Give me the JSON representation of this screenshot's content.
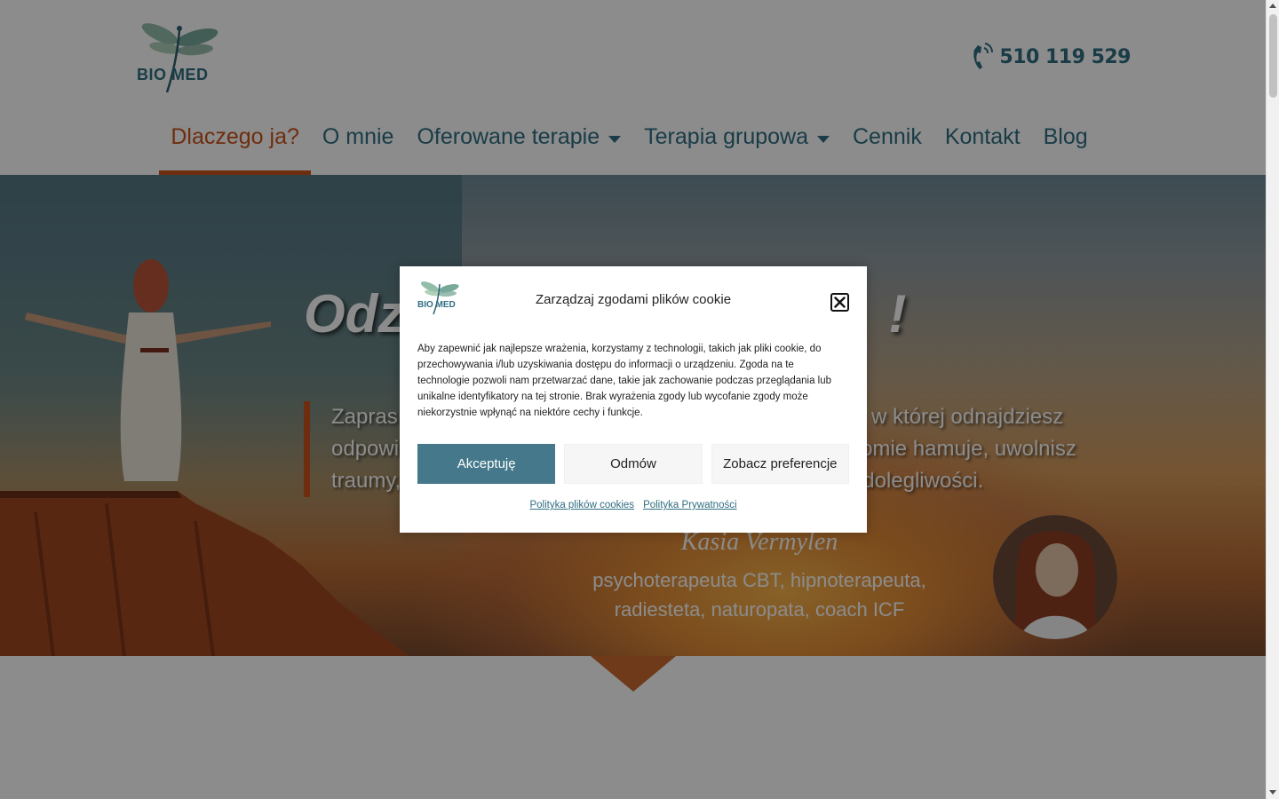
{
  "header": {
    "logo_text": "BIO MED",
    "phone": "510 119 529"
  },
  "nav": {
    "items": [
      {
        "label": "Dlaczego ja?",
        "active": true,
        "dropdown": false
      },
      {
        "label": "O mnie",
        "active": false,
        "dropdown": false
      },
      {
        "label": "Oferowane terapie",
        "active": false,
        "dropdown": true
      },
      {
        "label": "Terapia grupowa",
        "active": false,
        "dropdown": true
      },
      {
        "label": "Cennik",
        "active": false,
        "dropdown": false
      },
      {
        "label": "Kontakt",
        "active": false,
        "dropdown": false
      },
      {
        "label": "Blog",
        "active": false,
        "dropdown": false
      }
    ]
  },
  "hero": {
    "title_start": "Odz",
    "title_end": "!",
    "text_line1_start": "Zapras",
    "text_line1_end": ", w której odnajdziesz",
    "text_line2_start": "odpowi",
    "text_line2_end": "omie hamuje, uwolnisz",
    "text_line3_start": "traumy,",
    "text_line3_end": "dolegliwości.",
    "author_name": "Kasia Vermylen",
    "author_role": "psychoterapeuta CBT, hipnoterapeuta, radiesteta, naturopata, coach ICF"
  },
  "cookie_modal": {
    "logo_text": "BIO MED",
    "title": "Zarządzaj zgodami plików cookie",
    "body": "Aby zapewnić jak najlepsze wrażenia, korzystamy z technologii, takich jak pliki cookie, do przechowywania i/lub uzyskiwania dostępu do informacji o urządzeniu. Zgoda na te technologie pozwoli nam przetwarzać dane, takie jak zachowanie podczas przeglądania lub unikalne identyfikatory na tej stronie. Brak wyrażenia zgody lub wycofanie zgody może niekorzystnie wpłynąć na niektóre cechy i funkcje.",
    "accept_label": "Akceptuję",
    "deny_label": "Odmów",
    "preferences_label": "Zobacz preferencje",
    "cookie_policy_link": "Polityka plików cookies",
    "privacy_policy_link": "Polityka Prywatności"
  },
  "colors": {
    "brand_teal": "#2f6e82",
    "accent_orange": "#c9531b",
    "accept_button": "#44788a"
  }
}
